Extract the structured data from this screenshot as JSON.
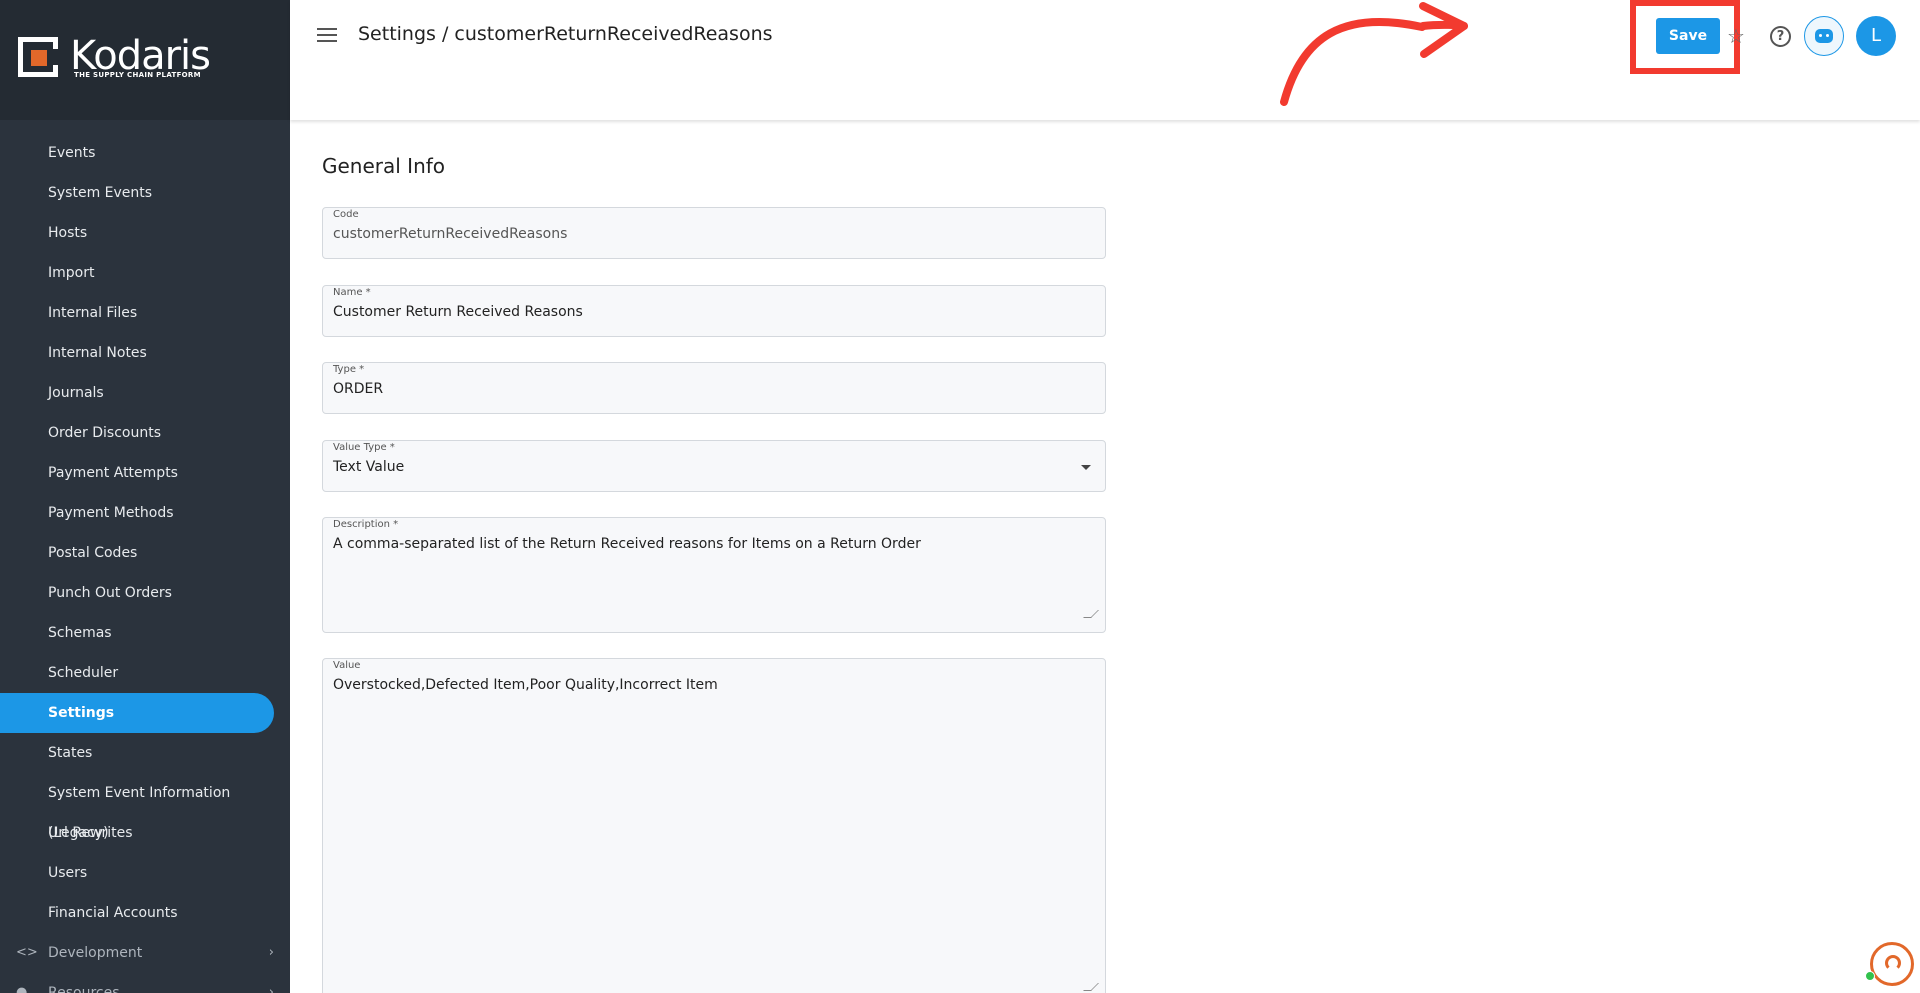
{
  "app": {
    "logo_text": "Kodaris",
    "logo_tagline": "THE SUPPLY CHAIN PLATFORM"
  },
  "sidebar": {
    "items": [
      {
        "label": "Events"
      },
      {
        "label": "System Events"
      },
      {
        "label": "Hosts"
      },
      {
        "label": "Import"
      },
      {
        "label": "Internal Files"
      },
      {
        "label": "Internal Notes"
      },
      {
        "label": "Journals"
      },
      {
        "label": "Order Discounts"
      },
      {
        "label": "Payment Attempts"
      },
      {
        "label": "Payment Methods"
      },
      {
        "label": "Postal Codes"
      },
      {
        "label": "Punch Out Orders"
      },
      {
        "label": "Schemas"
      },
      {
        "label": "Scheduler"
      },
      {
        "label": "Settings",
        "active": true
      },
      {
        "label": "States"
      },
      {
        "label": "System Event Information (Legacy)"
      },
      {
        "label": "Url Rewrites"
      },
      {
        "label": "Users"
      },
      {
        "label": "Financial Accounts"
      }
    ],
    "groups": [
      {
        "label": "Development",
        "icon": "code-icon"
      },
      {
        "label": "Resources",
        "icon": "help-circle-icon"
      }
    ]
  },
  "header": {
    "title": "Settings / customerReturnReceivedReasons",
    "save_label": "Save",
    "avatar_initial": "L"
  },
  "form": {
    "section_title": "General Info",
    "code": {
      "label": "Code",
      "value": "customerReturnReceivedReasons"
    },
    "name": {
      "label": "Name *",
      "value": "Customer Return Received Reasons"
    },
    "type": {
      "label": "Type *",
      "value": "ORDER"
    },
    "value_type": {
      "label": "Value Type *",
      "value": "Text Value"
    },
    "description": {
      "label": "Description *",
      "value": "A comma-separated list of the Return Received reasons for Items on a Return Order"
    },
    "value": {
      "label": "Value",
      "value": "Overstocked,Defected Item,Poor Quality,Incorrect Item"
    }
  },
  "colors": {
    "accent": "#1c97e6",
    "sidebar_bg": "#2b333d",
    "annotation": "#f23a2f",
    "brand_orange": "#e2682a"
  }
}
